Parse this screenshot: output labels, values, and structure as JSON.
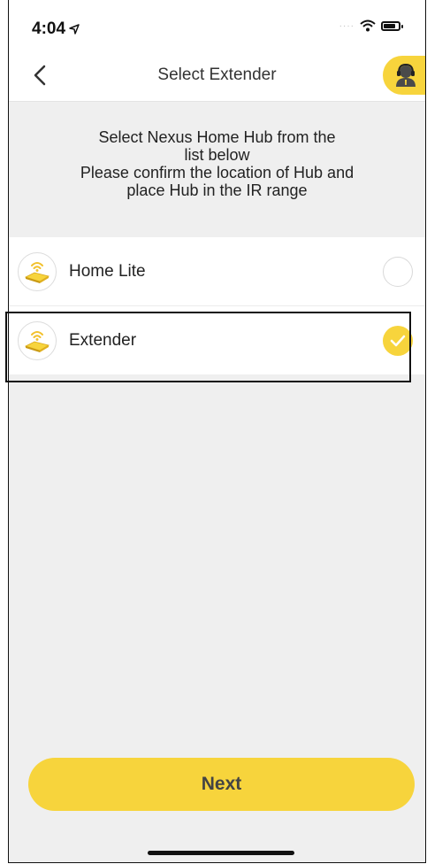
{
  "status_bar": {
    "time": "4:04"
  },
  "header": {
    "title": "Select Extender"
  },
  "instructions": {
    "line1": "Select Nexus Home Hub from the",
    "line2": "list below",
    "line3": "Please confirm the location of Hub and",
    "line4": "place Hub in the IR range"
  },
  "devices": [
    {
      "label": "Home Lite",
      "selected": false
    },
    {
      "label": "Extender",
      "selected": true
    }
  ],
  "footer": {
    "next_label": "Next"
  },
  "colors": {
    "accent": "#f7d43c",
    "background": "#efefef"
  }
}
